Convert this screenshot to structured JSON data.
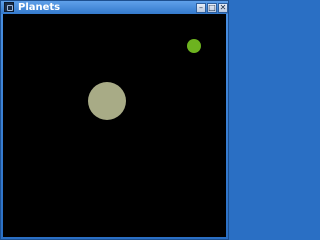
{
  "window": {
    "title": "Planets",
    "controls": {
      "minimize_icon": "minimize-icon",
      "maximize_icon": "maximize-icon",
      "close_icon": "close-icon",
      "minimize_glyph": "–",
      "maximize_glyph": "□",
      "close_glyph": "✕"
    },
    "titlebar_color": "#3479cc"
  },
  "scene": {
    "background_color": "#000000",
    "planets": [
      {
        "name": "large-planet",
        "color": "#a8ab86"
      },
      {
        "name": "small-planet",
        "color": "#6db31f"
      }
    ]
  }
}
